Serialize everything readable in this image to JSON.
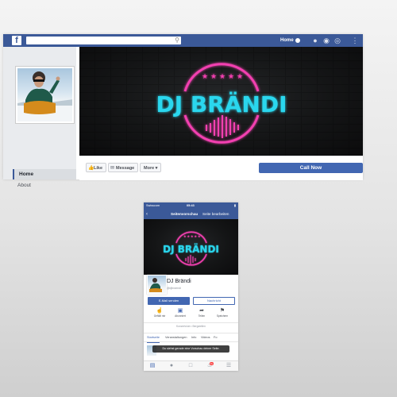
{
  "colors": {
    "facebook_blue": "#3b5998",
    "button_blue": "#4267b2",
    "neon_cyan": "#29d7ee",
    "neon_pink": "#f23fb0",
    "cover_dark": "#141516"
  },
  "desktop": {
    "logo_letter": "f",
    "search": {
      "placeholder": "",
      "icon": "search-icon"
    },
    "topbar": {
      "home_label": "Home",
      "icons": [
        "friends-icon",
        "messenger-icon",
        "globe-icon",
        "help-icon"
      ]
    },
    "nav": [
      {
        "label": "Home",
        "active": true
      },
      {
        "label": "About",
        "active": false
      }
    ],
    "cover_logo_text": "DJ BRÄNDI",
    "actions": {
      "like": "Like",
      "message": "Message",
      "more": "More",
      "call_now": "Call Now"
    }
  },
  "mobile": {
    "status": {
      "carrier": "Swisscom",
      "time": "05:43",
      "battery": ""
    },
    "header": {
      "back_icon": "back-arrow-icon",
      "title": "Seitenvorschau",
      "edit": "Seite bearbeiten"
    },
    "cover_logo_text": "DJ BRÄNDI",
    "page_name": "DJ Brändi",
    "handle": "@djbraendi",
    "buttons": {
      "email": "E-Mail senden",
      "message": "Nachricht"
    },
    "actions": [
      {
        "label": "Gefällt mir",
        "icon": "thumbs-up-icon"
      },
      {
        "label": "Abonniert",
        "icon": "follow-icon"
      },
      {
        "label": "Teilen",
        "icon": "share-icon"
      },
      {
        "label": "Speichern",
        "icon": "bookmark-icon"
      }
    ],
    "subline": "Konzertclub • Bergstellen",
    "tabs": [
      "Startseite",
      "Veranstaltungen",
      "Info",
      "Videos",
      "Fo"
    ],
    "toast": "Du siehst gerade eine Vorschau deiner Seite.",
    "bottom_nav": [
      "feed-icon",
      "friends-icon",
      "marketplace-icon",
      "notifications-icon",
      "menu-icon"
    ],
    "notification_badge": "9+"
  }
}
